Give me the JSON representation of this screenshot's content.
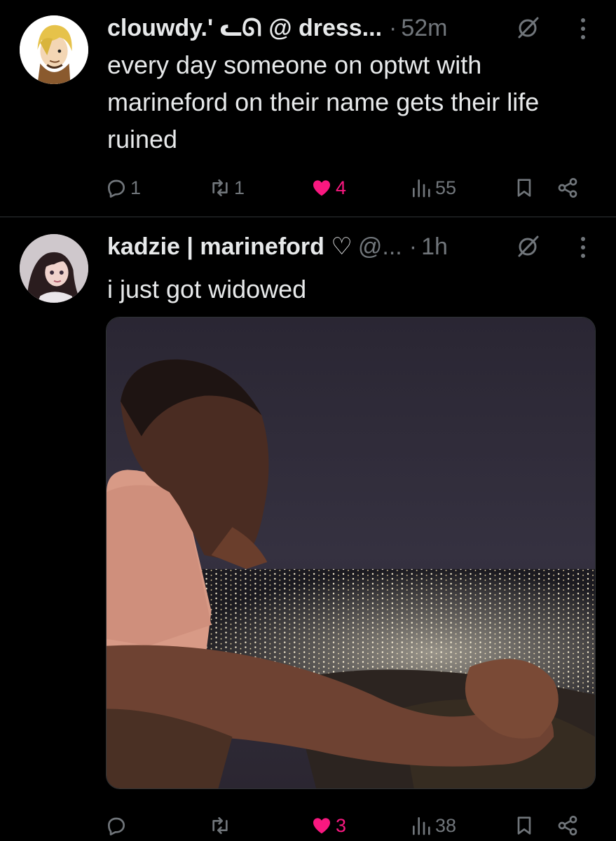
{
  "tweets": [
    {
      "display_name": "clouwdy.ʹ ᓚᘏ",
      "handle": "@ dress...",
      "separator": "·",
      "time": "52m",
      "text": "every day someone on optwt with marineford on their name gets their life ruined",
      "avatar_icon": "anime-avatar-icon",
      "stats": {
        "replies": "1",
        "retweets": "1",
        "likes": "4",
        "views": "55"
      },
      "liked": true
    },
    {
      "display_name": "kadzie | marineford ♡",
      "handle": "@...",
      "separator": "·",
      "time": "1h",
      "text": "i just got widowed",
      "avatar_icon": "anime-avatar-icon",
      "media": "photo-man-overlooking-city-lights",
      "stats": {
        "replies": "",
        "retweets": "",
        "likes": "3",
        "views": "38"
      },
      "liked": true
    }
  ],
  "colors": {
    "background": "#000000",
    "text_primary": "#e7e9ea",
    "text_secondary": "#71767b",
    "like_pink": "#f91880",
    "divider": "#2f3336"
  },
  "icons": [
    "reply-icon",
    "retweet-icon",
    "heart-icon",
    "views-icon",
    "bookmark-icon",
    "share-icon",
    "grok-icon",
    "more-icon"
  ]
}
